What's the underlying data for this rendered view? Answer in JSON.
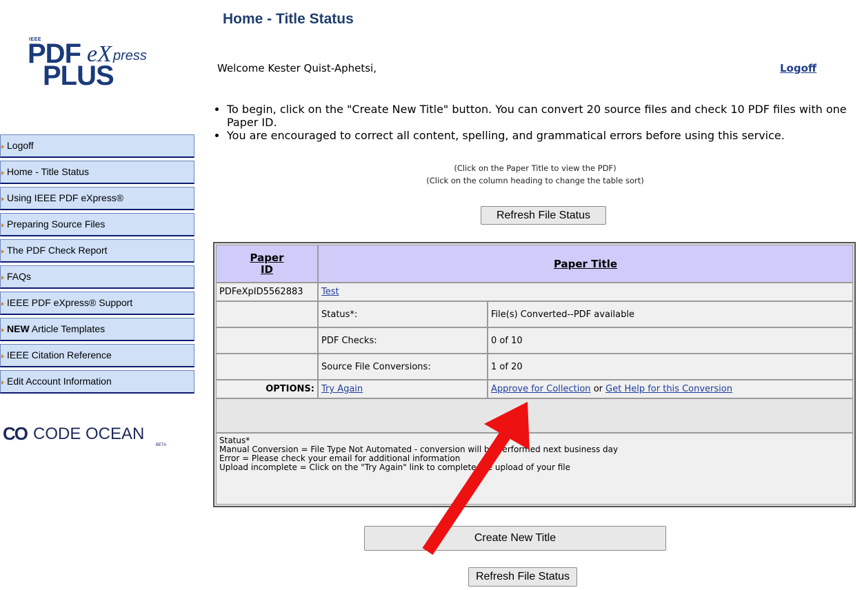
{
  "logo": {
    "ieee": "IEEE",
    "pdf": "PDF",
    "e": "eX",
    "press": "press",
    "plus": "PLUS"
  },
  "header": {
    "title": "Home - Title Status",
    "welcome": "Welcome Kester Quist-Aphetsi,",
    "logoff": "Logoff"
  },
  "sidebar": {
    "items": [
      {
        "label": "Logoff"
      },
      {
        "label": "Home - Title Status"
      },
      {
        "label": "Using IEEE PDF eXpress®"
      },
      {
        "label": "Preparing Source Files"
      },
      {
        "label": "The PDF Check Report"
      },
      {
        "label": "FAQs"
      },
      {
        "label": "IEEE PDF eXpress® Support"
      },
      {
        "label_bold": "NEW",
        "label": " Article Templates"
      },
      {
        "label": "IEEE Citation Reference"
      },
      {
        "label": "Edit Account Information"
      }
    ]
  },
  "codeocean": {
    "mark": "CO",
    "text": "CODE OCEAN",
    "beta": "BETA"
  },
  "instructions": [
    "To begin, click on the \"Create New Title\" button. You can convert 20 source files and check 10 PDF files with one Paper ID.",
    "You are encouraged to correct all content, spelling, and grammatical errors before using this service."
  ],
  "hints": {
    "line1": "(Click on the Paper Title to view the PDF)",
    "line2": "(Click on the column heading to change the table sort)"
  },
  "buttons": {
    "refresh": "Refresh File Status",
    "create": "Create New Title"
  },
  "table": {
    "col_paper_id": "Paper ID",
    "col_paper_title": "Paper Title",
    "paper_id": "PDFeXpID5562883",
    "paper_title": "Test",
    "rows": [
      {
        "label": "Status*:",
        "value": "File(s) Converted--PDF available"
      },
      {
        "label": "PDF Checks:",
        "value": "0 of 10"
      },
      {
        "label": "Source File Conversions:",
        "value": "1 of 20"
      }
    ],
    "options_label": "OPTIONS:",
    "try_again": "Try Again",
    "approve": "Approve for Collection",
    "or": "or",
    "get_help": "Get Help for this Conversion"
  },
  "status_notes": [
    "Status*",
    "Manual Conversion = File Type Not Automated - conversion will be performed next business day",
    "Error = Please check your email for additional information",
    "Upload incomplete = Click on the \"Try Again\" link to complete the upload of your file"
  ],
  "colors": {
    "nav_bg": "#cfe0f7",
    "header_bg": "#d0ccfa",
    "title": "#1f3e6e",
    "arrow": "#ee1111"
  }
}
